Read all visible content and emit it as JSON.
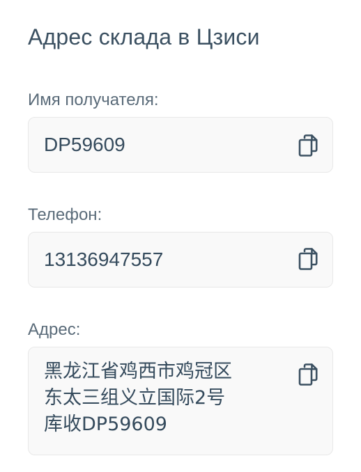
{
  "title": "Адрес склада в Цзиси",
  "fields": [
    {
      "label": "Имя получателя:",
      "value": "DP59609",
      "copy_icon": "copy-icon"
    },
    {
      "label": "Телефон:",
      "value": "13136947557",
      "copy_icon": "copy-icon"
    },
    {
      "label": "Адрес:",
      "value": "黑龙江省鸡西市鸡冠区\n东太三组义立国际2号\n库收DP59609",
      "copy_icon": "copy-icon"
    }
  ],
  "colors": {
    "text": "#3b5061",
    "label": "#5a6b79",
    "box_background": "#f9f9f9",
    "box_border": "#e8e8e8"
  }
}
